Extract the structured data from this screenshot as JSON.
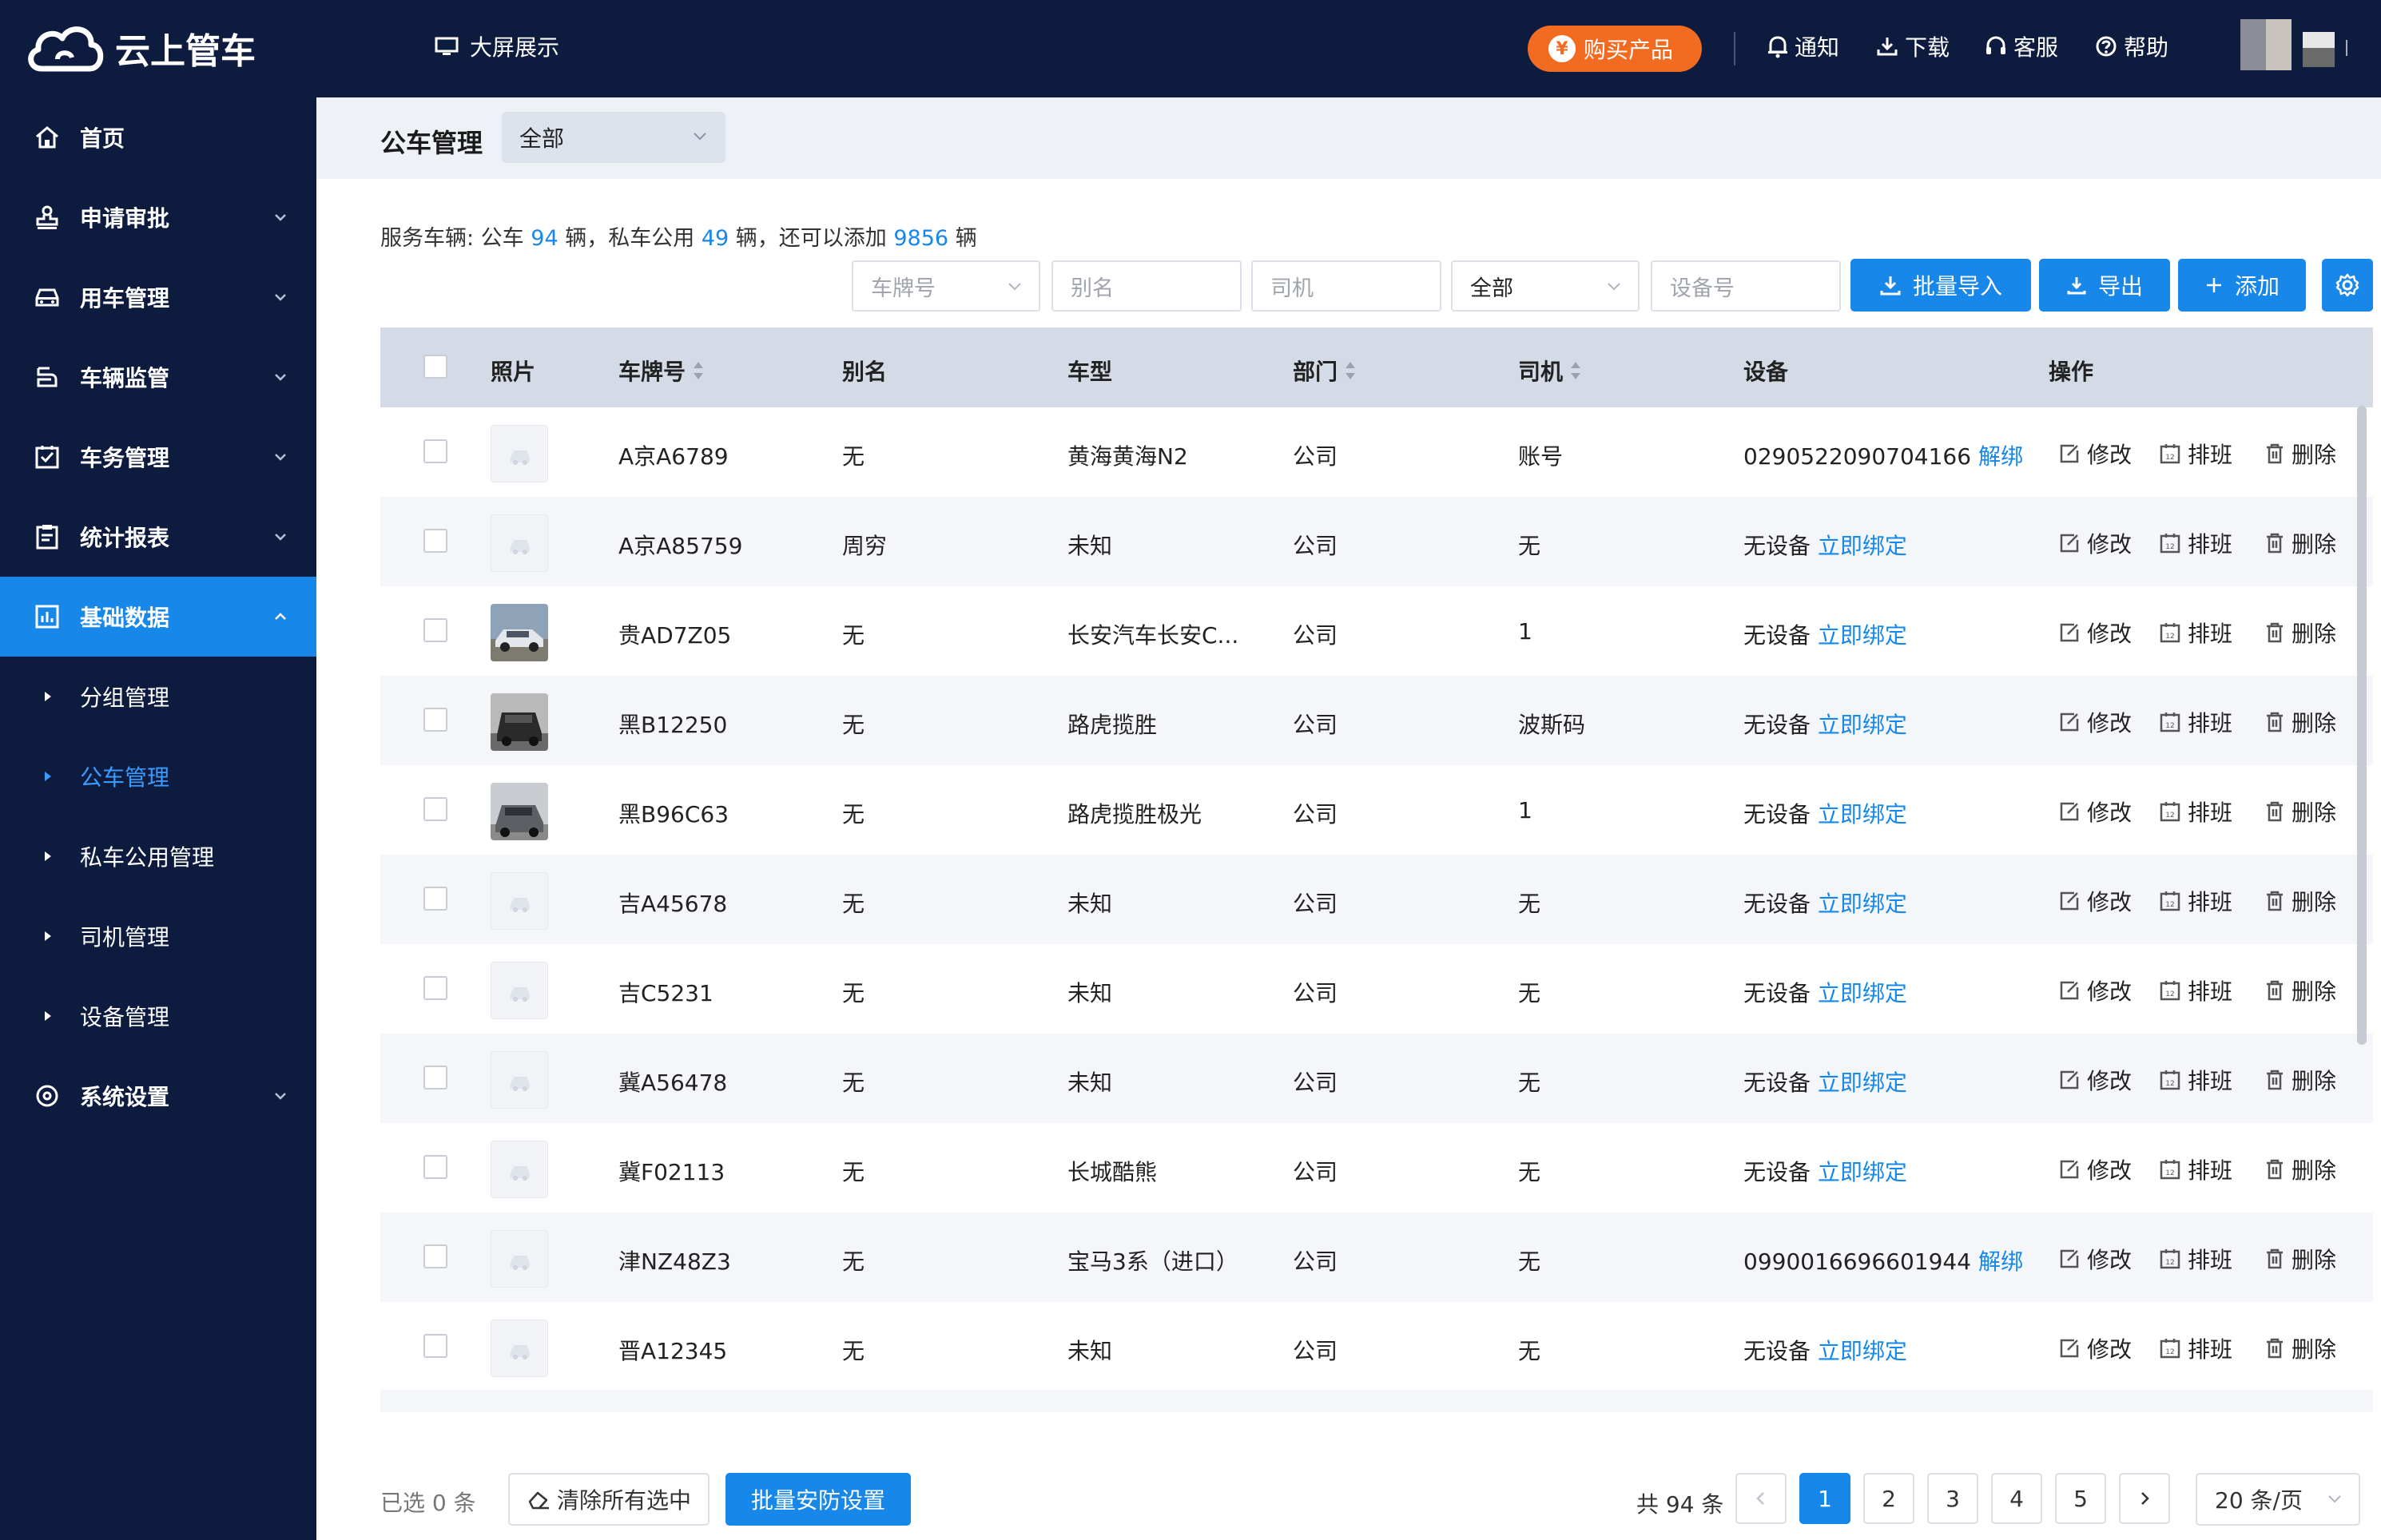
{
  "app": {
    "title": "云上管车"
  },
  "topbar": {
    "big_screen": "大屏展示",
    "buy": "购买产品",
    "buy_coin": "¥",
    "notify": "通知",
    "download": "下载",
    "service": "客服",
    "help": "帮助"
  },
  "sidebar": {
    "items": [
      {
        "label": "首页",
        "icon": "home-icon"
      },
      {
        "label": "申请审批",
        "icon": "stamp-icon"
      },
      {
        "label": "用车管理",
        "icon": "car-icon"
      },
      {
        "label": "车辆监管",
        "icon": "monitor-icon"
      },
      {
        "label": "车务管理",
        "icon": "check-square-icon"
      },
      {
        "label": "统计报表",
        "icon": "clipboard-icon"
      },
      {
        "label": "基础数据",
        "icon": "chart-icon"
      }
    ],
    "subitems": [
      {
        "label": "分组管理"
      },
      {
        "label": "公车管理"
      },
      {
        "label": "私车公用管理"
      },
      {
        "label": "司机管理"
      },
      {
        "label": "设备管理"
      }
    ],
    "settings": {
      "label": "系统设置",
      "icon": "settings-icon"
    }
  },
  "page": {
    "title": "公车管理",
    "scope": "全部"
  },
  "summary": {
    "prefix": "服务车辆: 公车",
    "public_count": "94",
    "mid1": "辆，私车公用",
    "private_count": "49",
    "mid2": "辆，还可以添加",
    "remaining": "9856",
    "suffix": "辆"
  },
  "filters": {
    "plate_placeholder": "车牌号",
    "alias_placeholder": "别名",
    "driver_placeholder": "司机",
    "status_value": "全部",
    "device_placeholder": "设备号"
  },
  "actions": {
    "import": "批量导入",
    "export": "导出",
    "add": "添加"
  },
  "table": {
    "headers": {
      "photo": "照片",
      "plate": "车牌号",
      "alias": "别名",
      "model": "车型",
      "dept": "部门",
      "driver": "司机",
      "device": "设备",
      "ops": "操作"
    },
    "op_labels": {
      "edit": "修改",
      "schedule": "排班",
      "delete": "删除",
      "schedule_icon_text": "12"
    },
    "rows": [
      {
        "photo": "none",
        "plate": "A京A6789",
        "alias": "无",
        "model": "黄海黄海N2",
        "dept": "公司",
        "driver": "账号",
        "device": "0290522090704166",
        "device_action": "解绑"
      },
      {
        "photo": "none",
        "plate": "A京A85759",
        "alias": "周穷",
        "model": "未知",
        "dept": "公司",
        "driver": "无",
        "device": "无设备",
        "device_action": "立即绑定"
      },
      {
        "photo": "silver",
        "plate": "贵AD7Z05",
        "alias": "无",
        "model": "长安汽车长安C...",
        "dept": "公司",
        "driver": "1",
        "device": "无设备",
        "device_action": "立即绑定"
      },
      {
        "photo": "dark",
        "plate": "黑B12250",
        "alias": "无",
        "model": "路虎揽胜",
        "dept": "公司",
        "driver": "波斯码",
        "device": "无设备",
        "device_action": "立即绑定"
      },
      {
        "photo": "gray",
        "plate": "黑B96C63",
        "alias": "无",
        "model": "路虎揽胜极光",
        "dept": "公司",
        "driver": "1",
        "device": "无设备",
        "device_action": "立即绑定"
      },
      {
        "photo": "none",
        "plate": "吉A45678",
        "alias": "无",
        "model": "未知",
        "dept": "公司",
        "driver": "无",
        "device": "无设备",
        "device_action": "立即绑定"
      },
      {
        "photo": "none",
        "plate": "吉C5231",
        "alias": "无",
        "model": "未知",
        "dept": "公司",
        "driver": "无",
        "device": "无设备",
        "device_action": "立即绑定"
      },
      {
        "photo": "none",
        "plate": "冀A56478",
        "alias": "无",
        "model": "未知",
        "dept": "公司",
        "driver": "无",
        "device": "无设备",
        "device_action": "立即绑定"
      },
      {
        "photo": "none",
        "plate": "冀F02113",
        "alias": "无",
        "model": "长城酷熊",
        "dept": "公司",
        "driver": "无",
        "device": "无设备",
        "device_action": "立即绑定"
      },
      {
        "photo": "none",
        "plate": "津NZ48Z3",
        "alias": "无",
        "model": "宝马3系（进口）",
        "dept": "公司",
        "driver": "无",
        "device": "0990016696601944",
        "device_action": "解绑"
      },
      {
        "photo": "none",
        "plate": "晋A12345",
        "alias": "无",
        "model": "未知",
        "dept": "公司",
        "driver": "无",
        "device": "无设备",
        "device_action": "立即绑定"
      }
    ]
  },
  "footer": {
    "selected_prefix": "已选",
    "selected_count": "0",
    "selected_suffix": "条",
    "clear": "清除所有选中",
    "batch_security": "批量安防设置",
    "total": "共 94 条",
    "pages": [
      "1",
      "2",
      "3",
      "4",
      "5"
    ],
    "current_page": "1",
    "page_size": "20 条/页"
  },
  "colors": {
    "primary": "#1787ea",
    "sidebar_bg": "#0d1b3f",
    "buy": "#f36b21"
  }
}
